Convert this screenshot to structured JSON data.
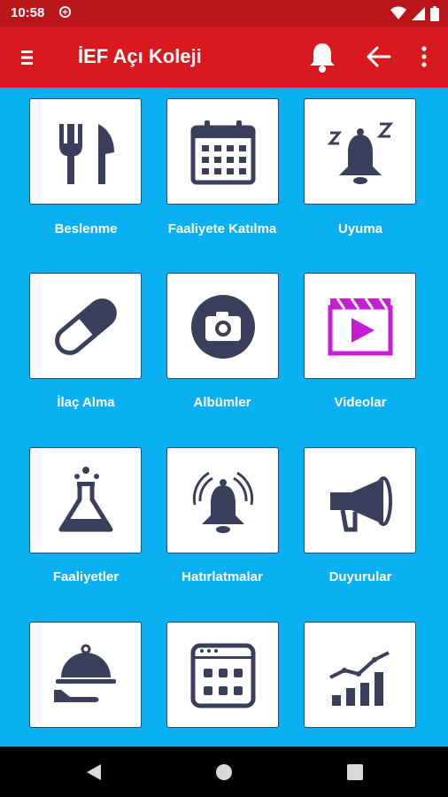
{
  "status_bar": {
    "time": "10:58",
    "icons": [
      "data-saver-icon",
      "wifi-icon",
      "signal-icon",
      "battery-icon"
    ]
  },
  "app_bar": {
    "title": "İEF Açı Koleji",
    "icons": [
      "menu-icon",
      "bell-icon",
      "back-arrow-icon",
      "more-vert-icon"
    ]
  },
  "colors": {
    "status_bar": "#b9161c",
    "app_bar": "#d8191f",
    "background": "#0ab0f2",
    "icon": "#3b3f5c",
    "video_accent": "#c51ed4"
  },
  "tiles": [
    {
      "label": "Beslenme",
      "icon": "fork-knife-icon"
    },
    {
      "label": "Faaliyete Katılma",
      "icon": "calendar-icon"
    },
    {
      "label": "Uyuma",
      "icon": "sleep-bell-icon"
    },
    {
      "label": "İlaç Alma",
      "icon": "pill-icon"
    },
    {
      "label": "Albümler",
      "icon": "camera-icon"
    },
    {
      "label": "Videolar",
      "icon": "video-clapper-icon"
    },
    {
      "label": "Faaliyetler",
      "icon": "flask-icon"
    },
    {
      "label": "Hatırlatmalar",
      "icon": "ringing-bell-icon"
    },
    {
      "label": "Duyurular",
      "icon": "megaphone-icon"
    },
    {
      "label": "",
      "icon": "food-tray-icon"
    },
    {
      "label": "",
      "icon": "schedule-icon"
    },
    {
      "label": "",
      "icon": "growth-chart-icon"
    }
  ],
  "nav_bar": {
    "icons": [
      "back-triangle-icon",
      "home-circle-icon",
      "recents-square-icon"
    ]
  }
}
